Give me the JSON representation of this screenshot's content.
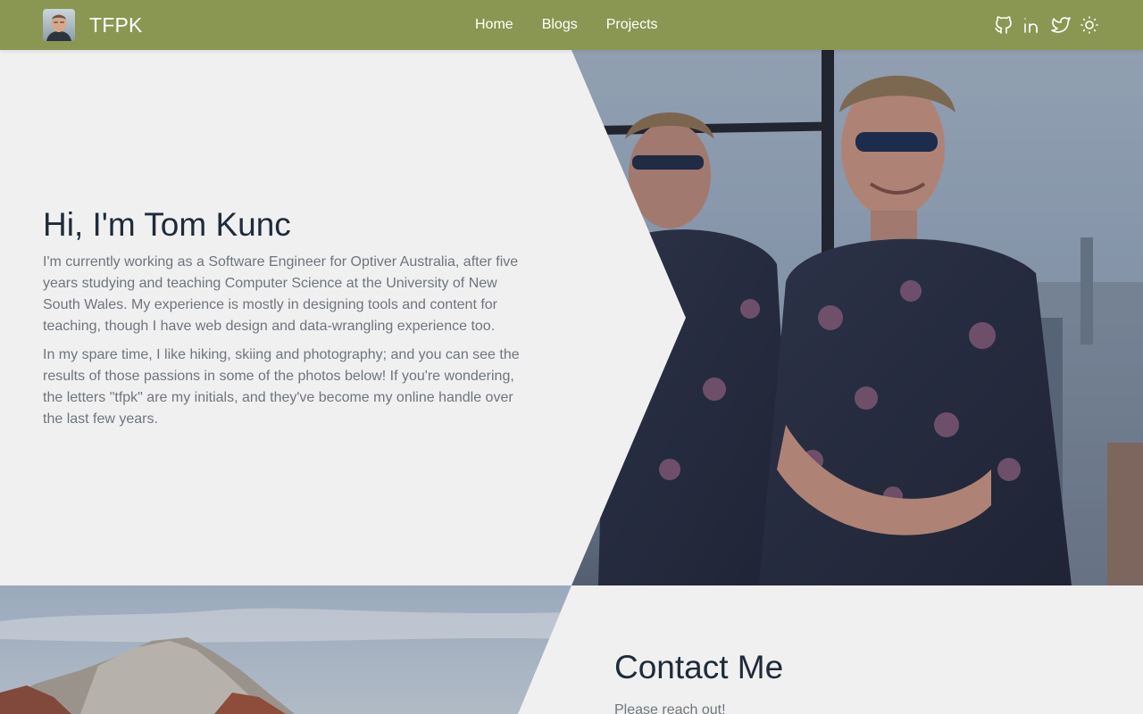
{
  "nav": {
    "brand": "TFPK",
    "links": [
      "Home",
      "Blogs",
      "Projects"
    ],
    "icons": [
      "github-icon",
      "linkedin-icon",
      "twitter-icon",
      "sun-icon"
    ]
  },
  "hero": {
    "title": "Hi, I'm Tom Kunc",
    "paragraphs": [
      "I'm currently working as a Software Engineer for Optiver Australia, after five years studying and teaching Computer Science at the University of New South Wales. My experience is mostly in designing tools and content for teaching, though I have web design and data-wrangling experience too.",
      "In my spare time, I like hiking, skiing and photography; and you can see the results of those passions in some of the photos below! If you're wondering, the letters \"tfpk\" are my initials, and they've become my online handle over the last few years."
    ]
  },
  "contact": {
    "title": "Contact Me",
    "text": "Please reach out!"
  },
  "colors": {
    "navbar": "#8a9752",
    "background": "#f0f0f0",
    "heading": "#1f2a3a",
    "body_text": "#6f757e"
  }
}
